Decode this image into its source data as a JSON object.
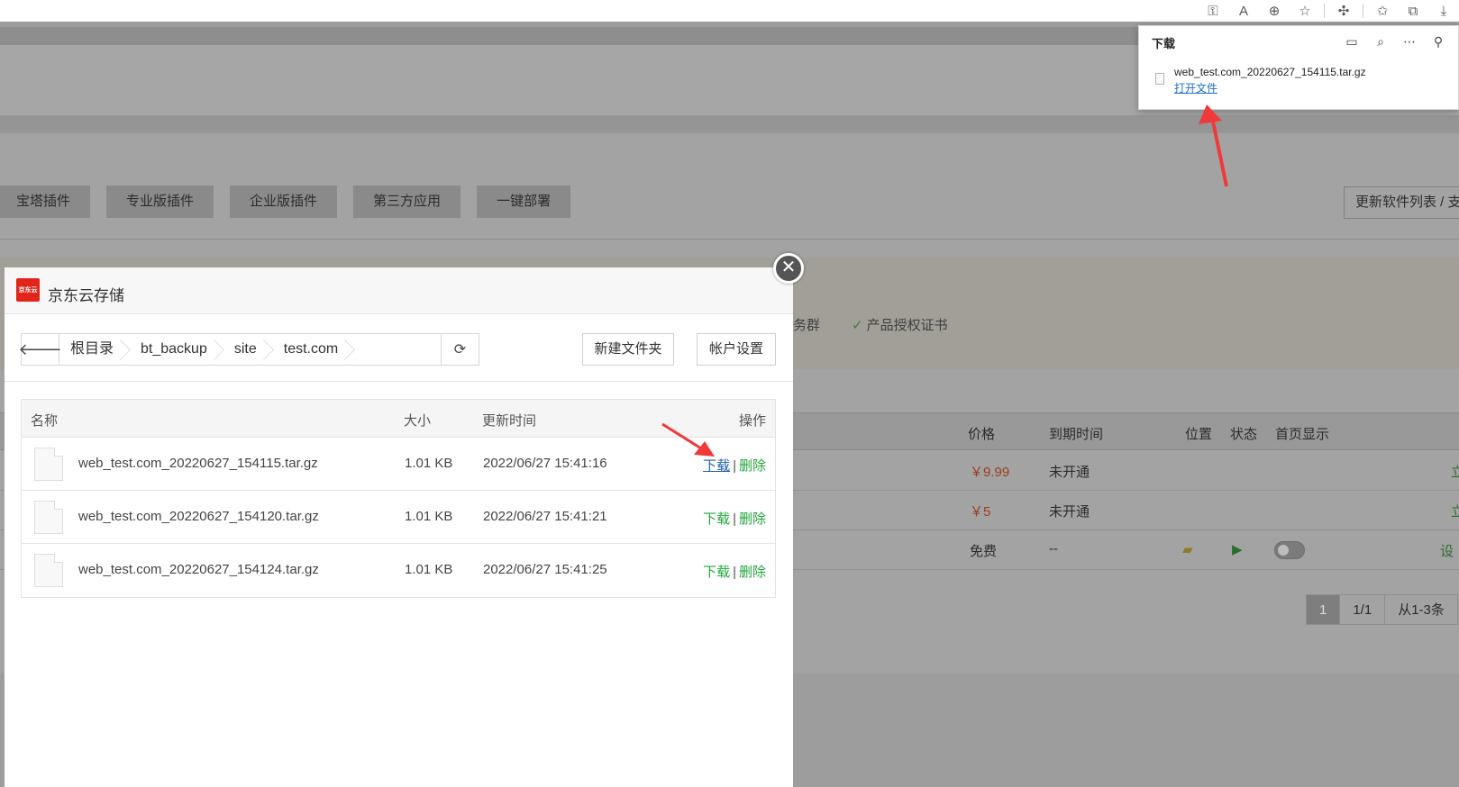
{
  "background": {
    "tabs": [
      "宝塔插件",
      "专业版插件",
      "企业版插件",
      "第三方应用",
      "一键部署"
    ],
    "update_button": "更新软件列表 / 支",
    "features": [
      "务群",
      "产品授权证书"
    ],
    "table": {
      "headers": {
        "price": "价格",
        "expire": "到期时间",
        "location": "位置",
        "status": "状态",
        "home": "首页显示"
      },
      "rows": [
        {
          "price": "￥9.99",
          "expire": "未开通",
          "action": "立"
        },
        {
          "price": "￥5",
          "expire": "未开通",
          "action": "立"
        },
        {
          "price": "免费",
          "expire": "--",
          "action": "设"
        }
      ]
    },
    "pager": {
      "current": "1",
      "pages": "1/1",
      "range": "从1-3条"
    }
  },
  "downloads_panel": {
    "title": "下载",
    "file_name": "web_test.com_20220627_154115.tar.gz",
    "open_file": "打开文件"
  },
  "modal": {
    "title": "京东云存储",
    "logo_text": "京东云",
    "breadcrumb": [
      "根目录",
      "bt_backup",
      "site",
      "test.com"
    ],
    "new_folder_button": "新建文件夹",
    "account_button": "帐户设置",
    "table": {
      "headers": {
        "name": "名称",
        "size": "大小",
        "time": "更新时间",
        "ops": "操作"
      },
      "download_label": "下载",
      "delete_label": "删除",
      "rows": [
        {
          "name": "web_test.com_20220627_154115.tar.gz",
          "size": "1.01 KB",
          "time": "2022/06/27 15:41:16"
        },
        {
          "name": "web_test.com_20220627_154120.tar.gz",
          "size": "1.01 KB",
          "time": "2022/06/27 15:41:21"
        },
        {
          "name": "web_test.com_20220627_154124.tar.gz",
          "size": "1.01 KB",
          "time": "2022/06/27 15:41:25"
        }
      ]
    }
  },
  "colors": {
    "annotation_arrow": "#f03a3a",
    "link_green": "#20a53a",
    "brand_red": "#e1251b"
  }
}
